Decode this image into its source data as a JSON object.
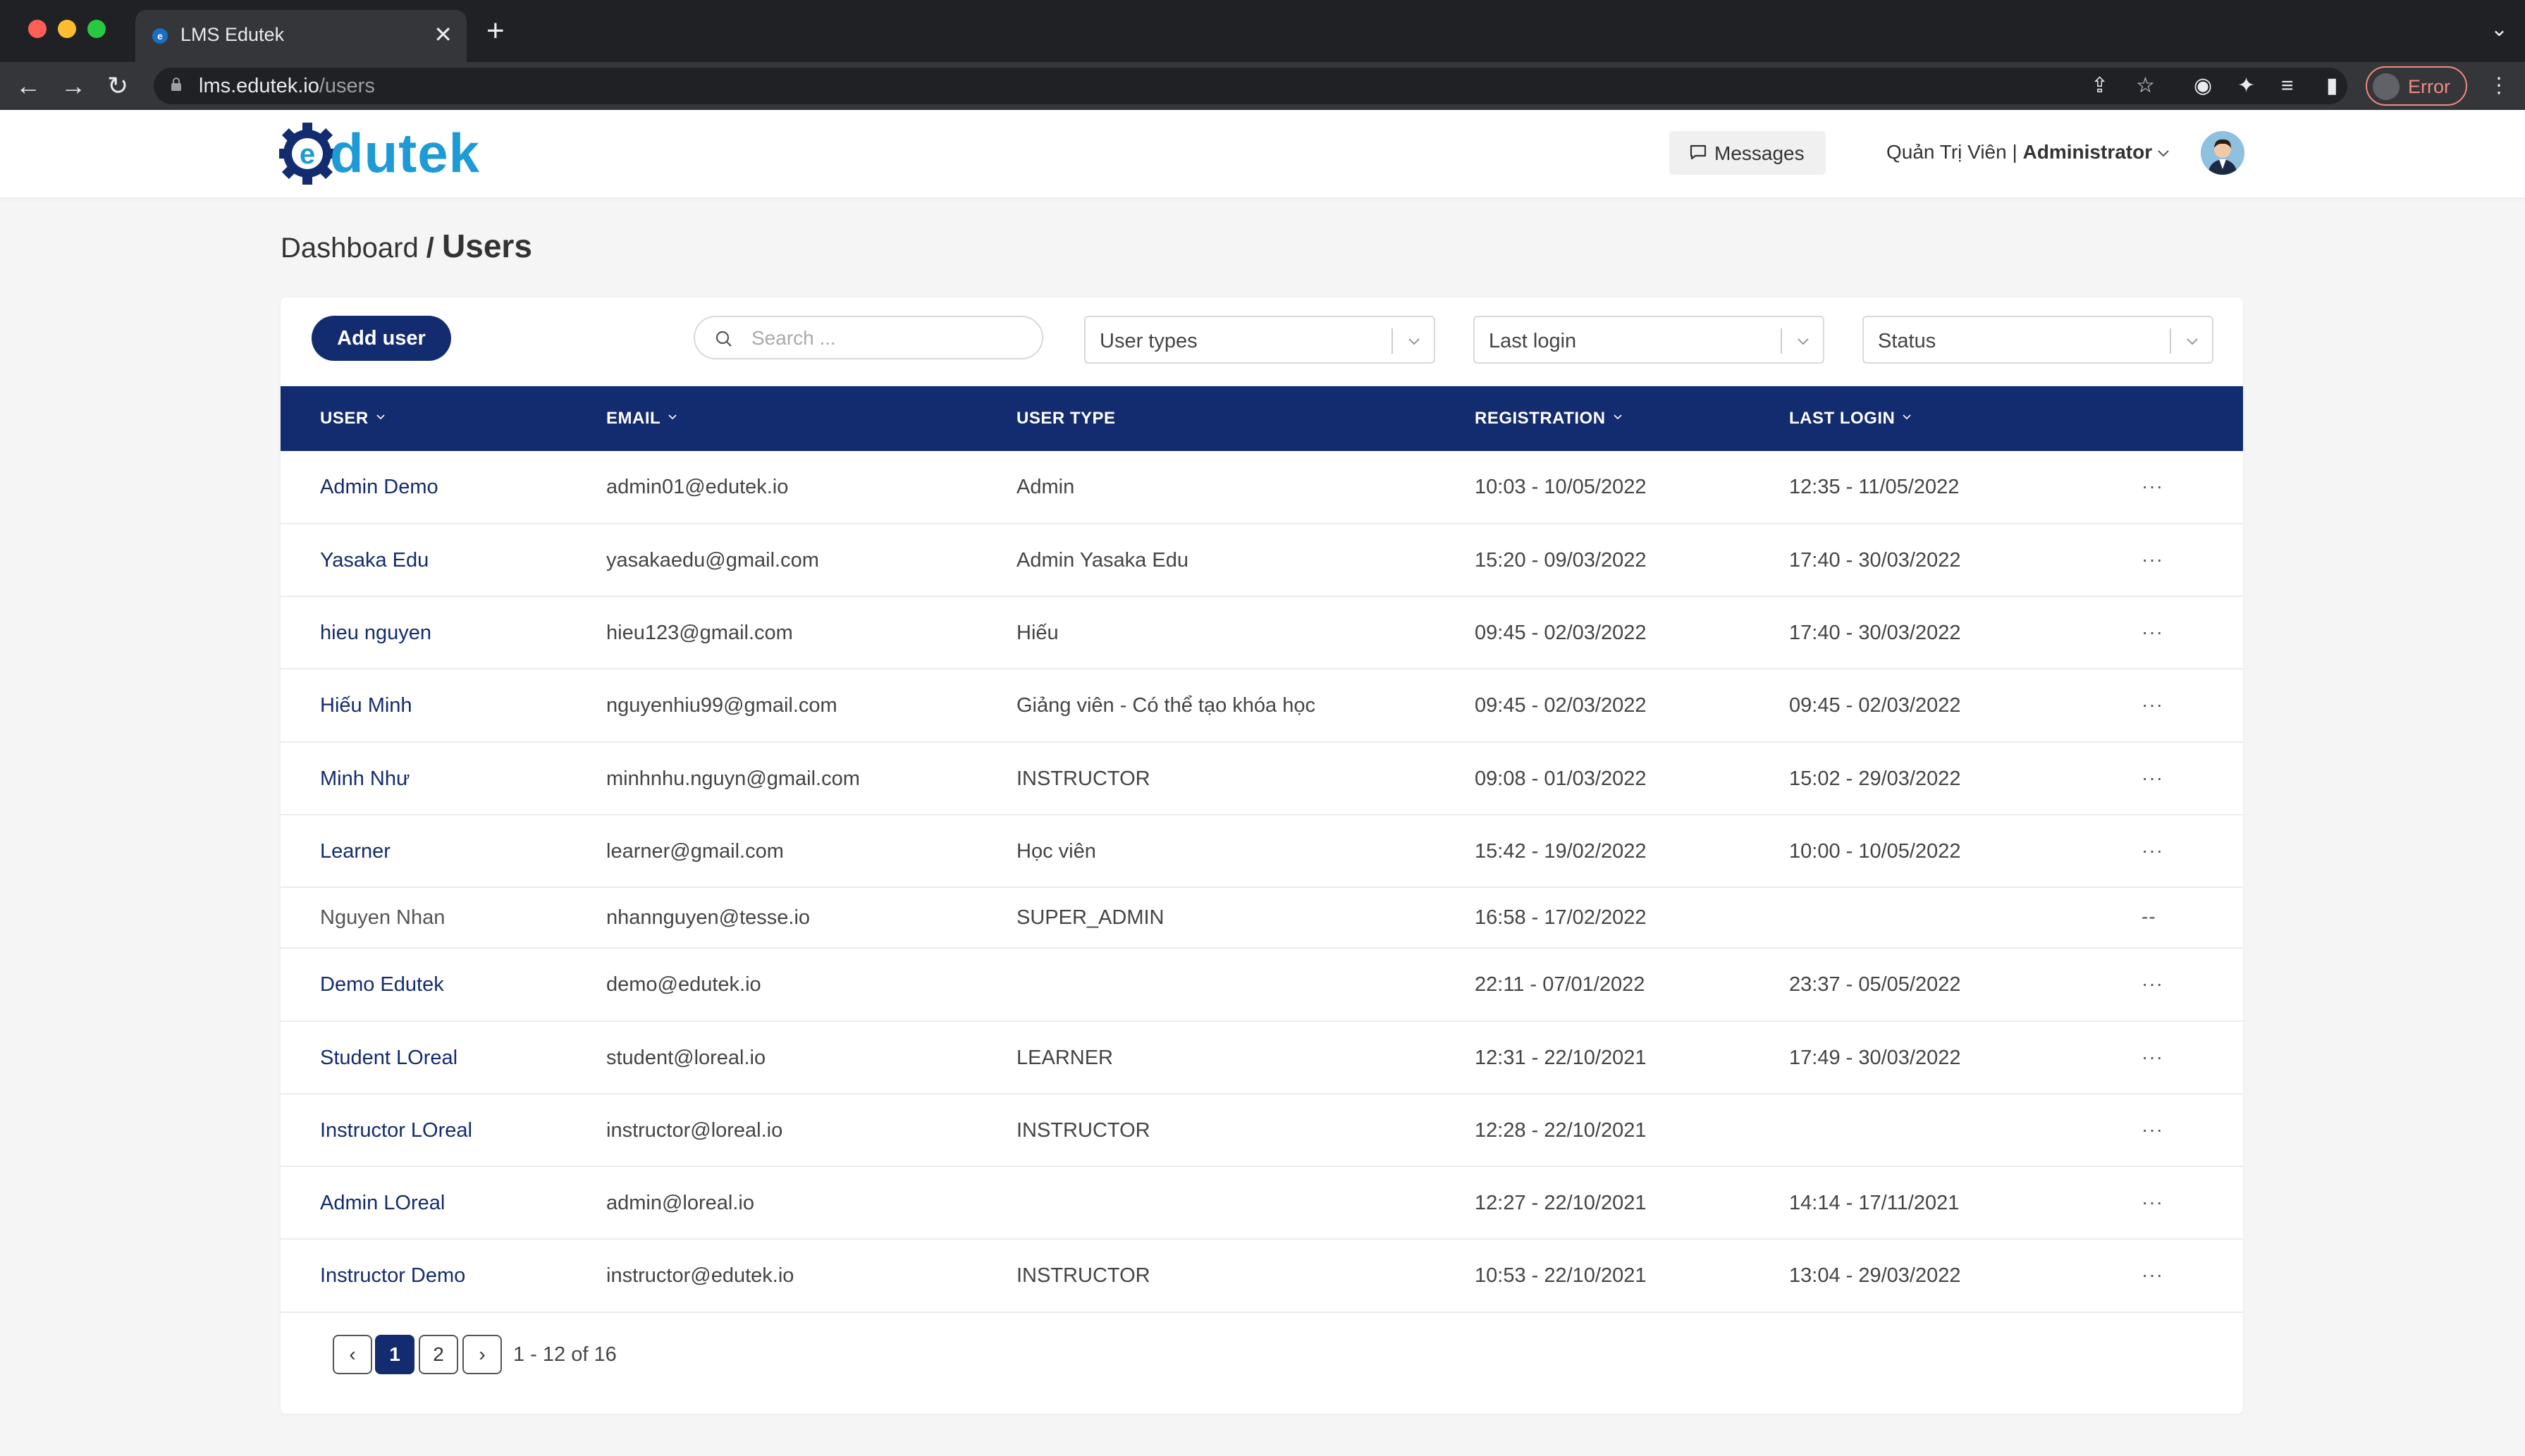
{
  "browser": {
    "tab_title": "LMS Edutek",
    "tab_close": "✕",
    "new_tab": "+",
    "url_host": "lms.edutek.io",
    "url_path": "/users",
    "error_label": "Error",
    "colors": {
      "close": "#ff5f57",
      "minimize": "#febc2e",
      "maximize": "#28c840"
    }
  },
  "header": {
    "logo_text": "dutek",
    "messages_label": "Messages",
    "user_name": "Quản Trị Viên",
    "user_sep": " | ",
    "user_role": "Administrator"
  },
  "breadcrumb": {
    "parent": "Dashboard",
    "sep": " / ",
    "current": "Users"
  },
  "toolbar": {
    "add_user_label": "Add user",
    "search_placeholder": "Search ...",
    "filter_user_types": "User types",
    "filter_last_login": "Last login",
    "filter_status": "Status"
  },
  "table": {
    "columns": [
      "USER",
      "EMAIL",
      "USER TYPE",
      "REGISTRATION",
      "LAST LOGIN"
    ],
    "rows": [
      {
        "user": "Admin Demo",
        "email": "admin01@edutek.io",
        "type": "Admin",
        "registration": "10:03 - 10/05/2022",
        "last_login": "12:35 - 11/05/2022",
        "action": "···"
      },
      {
        "user": "Yasaka Edu",
        "email": "yasakaedu@gmail.com",
        "type": "Admin Yasaka Edu",
        "registration": "15:20 - 09/03/2022",
        "last_login": "17:40 - 30/03/2022",
        "action": "···"
      },
      {
        "user": "hieu nguyen",
        "email": "hieu123@gmail.com",
        "type": "Hiếu",
        "registration": "09:45 - 02/03/2022",
        "last_login": "17:40 - 30/03/2022",
        "action": "···"
      },
      {
        "user": "Hiếu Minh",
        "email": "nguyenhiu99@gmail.com",
        "type": "Giảng viên - Có thể tạo khóa học",
        "registration": "09:45 - 02/03/2022",
        "last_login": "09:45 - 02/03/2022",
        "action": "···"
      },
      {
        "user": "Minh Như",
        "email": "minhnhu.nguyn@gmail.com",
        "type": "INSTRUCTOR",
        "registration": "09:08 - 01/03/2022",
        "last_login": "15:02 - 29/03/2022",
        "action": "···"
      },
      {
        "user": "Learner",
        "email": "learner@gmail.com",
        "type": "Học viên",
        "registration": "15:42 - 19/02/2022",
        "last_login": "10:00 - 10/05/2022",
        "action": "···"
      },
      {
        "user": "Nguyen Nhan",
        "email": "nhannguyen@tesse.io",
        "type": "SUPER_ADMIN",
        "registration": "16:58 - 17/02/2022",
        "last_login": "",
        "action": "--"
      },
      {
        "user": "Demo Edutek",
        "email": "demo@edutek.io",
        "type": "",
        "registration": "22:11 - 07/01/2022",
        "last_login": "23:37 - 05/05/2022",
        "action": "···"
      },
      {
        "user": "Student LOreal",
        "email": "student@loreal.io",
        "type": "LEARNER",
        "registration": "12:31 - 22/10/2021",
        "last_login": "17:49 - 30/03/2022",
        "action": "···"
      },
      {
        "user": "Instructor LOreal",
        "email": "instructor@loreal.io",
        "type": "INSTRUCTOR",
        "registration": "12:28 - 22/10/2021",
        "last_login": "",
        "action": "···"
      },
      {
        "user": "Admin LOreal",
        "email": "admin@loreal.io",
        "type": "",
        "registration": "12:27 - 22/10/2021",
        "last_login": "14:14 - 17/11/2021",
        "action": "···"
      },
      {
        "user": "Instructor Demo",
        "email": "instructor@edutek.io",
        "type": "INSTRUCTOR",
        "registration": "10:53 - 22/10/2021",
        "last_login": "13:04 - 29/03/2022",
        "action": "···"
      }
    ]
  },
  "pagination": {
    "prev": "‹",
    "pages": [
      "1",
      "2"
    ],
    "current_page": "1",
    "next": "›",
    "summary": "1 - 12 of 16"
  },
  "theme": {
    "primary": "#132b6f",
    "logo_blue": "#1e9ad6",
    "error": "#f28b82"
  }
}
